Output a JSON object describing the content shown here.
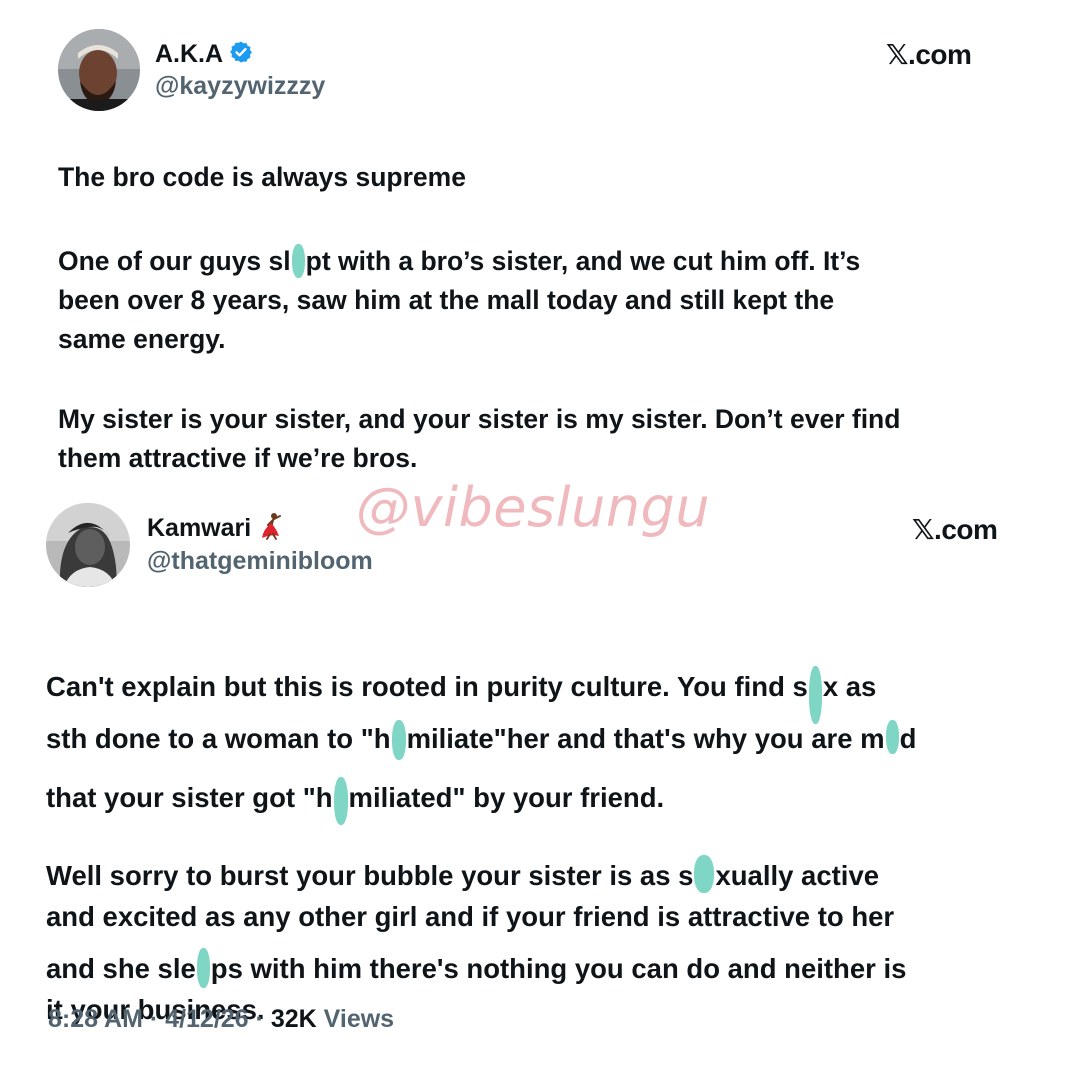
{
  "tweet1": {
    "display_name": "A.K.A",
    "handle": "@kayzywizzzy",
    "verified": true,
    "source_label": "𝕏.com",
    "lines": {
      "l1": "The bro code is always supreme",
      "l2a": "One of our guys sl",
      "l2b": "pt with a bro’s sister, and we cut him off. It’s",
      "l3": "been over 8 years, saw him at the mall today and still kept the",
      "l4": "same energy.",
      "l5": "My sister is your sister, and your sister is my sister. Don’t ever find",
      "l6": "them attractive if we’re bros."
    }
  },
  "watermark": "@vibeslungu",
  "tweet2": {
    "display_name": "Kamwari",
    "name_emoji": "dancer-emoji",
    "handle": "@thatgeminibloom",
    "source_label": "𝕏.com",
    "lines": {
      "a1a": "Can't explain but this is rooted in purity culture. You find s",
      "a1b": "x as",
      "a2a": "sth done to a woman to \"h",
      "a2b": "miliate\"her and that's why you are m",
      "a2c": "d",
      "a3a": "that your sister got \"h",
      "a3b": "miliated\" by your friend.",
      "b1a": "Well sorry to burst your bubble your sister is as s",
      "b1b": "xually active",
      "b2": "and excited as any other girl and if your friend is attractive to her",
      "b3a": "and she sle",
      "b3b": "ps with him there's nothing you can do and neither is",
      "b4": "it your business."
    },
    "meta": {
      "time": "8:28 AM",
      "sep": "·",
      "date": "4/12/26",
      "views_count": "32K",
      "views_label": "Views"
    }
  },
  "colors": {
    "text": "#0f1419",
    "secondary": "#536471",
    "verified_blue": "#1d9bf0",
    "censor_teal": "#7fd6c4",
    "watermark_pink": "#f0b9bd"
  },
  "icons": [
    "verified-badge-icon",
    "dancer-emoji",
    "x-logo-icon",
    "censor-mark"
  ]
}
